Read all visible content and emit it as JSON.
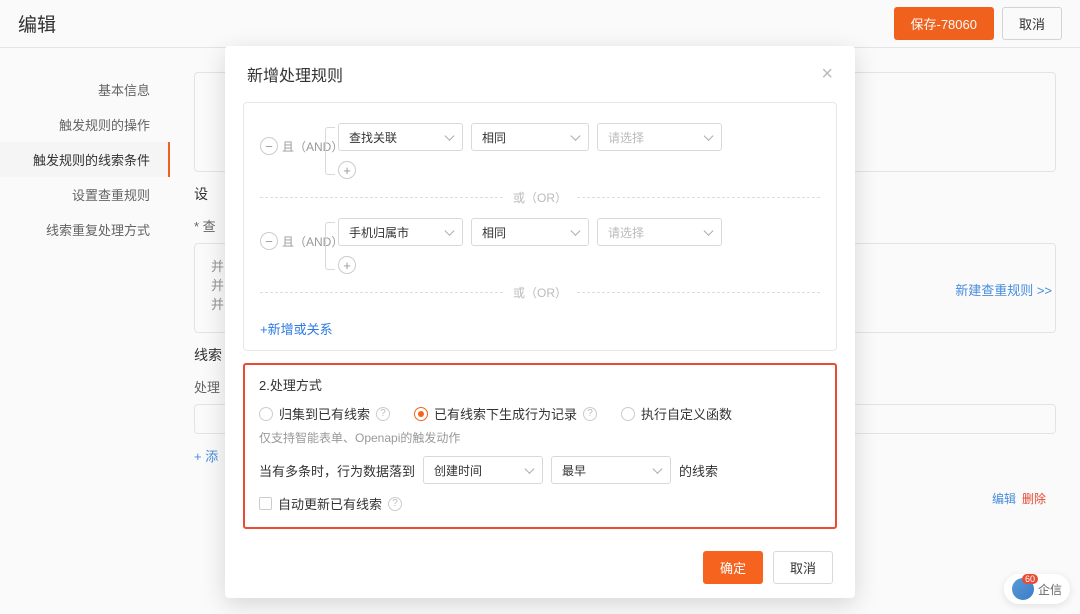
{
  "header": {
    "title": "编辑",
    "save_label": "保存-78060",
    "cancel_label": "取消"
  },
  "sidebar": {
    "items": [
      {
        "label": "基本信息"
      },
      {
        "label": "触发规则的操作"
      },
      {
        "label": "触发规则的线索条件"
      },
      {
        "label": "设置查重规则"
      },
      {
        "label": "线索重复处理方式"
      }
    ]
  },
  "main": {
    "section_set": "设",
    "dup_label": "* 查",
    "row_a": "并",
    "row_b": "并",
    "row_c": "并",
    "lead_sec": "线索",
    "proc": "处理",
    "add": "+ 添",
    "new_rule_link": "新建查重规则 >>",
    "edit": "编辑",
    "delete": "删除"
  },
  "modal": {
    "title": "新增处理规则",
    "and_label": "且（AND）",
    "or_label": "或（OR）",
    "add_or": "+新增或关系",
    "cond1": {
      "field": "查找关联",
      "op": "相同",
      "val_placeholder": "请选择"
    },
    "cond2": {
      "field": "手机归属市",
      "op": "相同",
      "val_placeholder": "请选择"
    },
    "section2_title": "2.处理方式",
    "radios": {
      "opt1": "归集到已有线索",
      "opt2": "已有线索下生成行为记录",
      "opt3": "执行自定义函数"
    },
    "hint": "仅支持智能表单、Openapi的触发动作",
    "multi_prefix": "当有多条时，行为数据落到",
    "multi_sel1": "创建时间",
    "multi_sel2": "最早",
    "multi_suffix": "的线索",
    "auto_update": "自动更新已有线索",
    "ok": "确定",
    "cancel": "取消"
  },
  "floaty": {
    "label": "企信",
    "badge": "60"
  }
}
